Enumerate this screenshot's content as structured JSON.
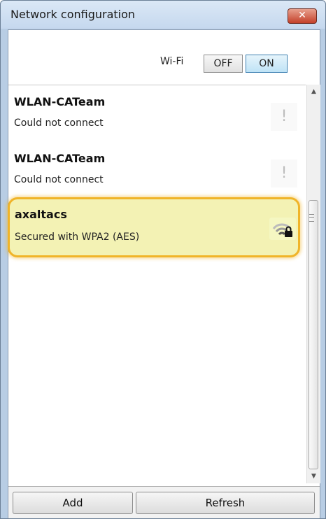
{
  "window": {
    "title": "Network configuration",
    "close_glyph": "✕"
  },
  "wifi": {
    "label": "Wi-Fi",
    "off_label": "OFF",
    "on_label": "ON",
    "state": "ON"
  },
  "networks": [
    {
      "name": "WLAN-CATeam",
      "status": "Could not connect",
      "icon": "warning-icon",
      "icon_glyph": "!"
    },
    {
      "name": "WLAN-CATeam",
      "status": "Could not connect",
      "icon": "warning-icon",
      "icon_glyph": "!"
    },
    {
      "name": "axaltacs",
      "status": "Secured with WPA2 (AES)",
      "icon": "wifi-lock-icon",
      "selected": true
    }
  ],
  "scrollbar": {
    "up_glyph": "▲",
    "down_glyph": "▼"
  },
  "footer": {
    "add_label": "Add",
    "refresh_label": "Refresh"
  },
  "colors": {
    "highlight_border": "#f0b429",
    "highlight_fill": "#f3f2b4",
    "toggle_on": "#bfe3f6",
    "close_button": "#c4402a"
  }
}
